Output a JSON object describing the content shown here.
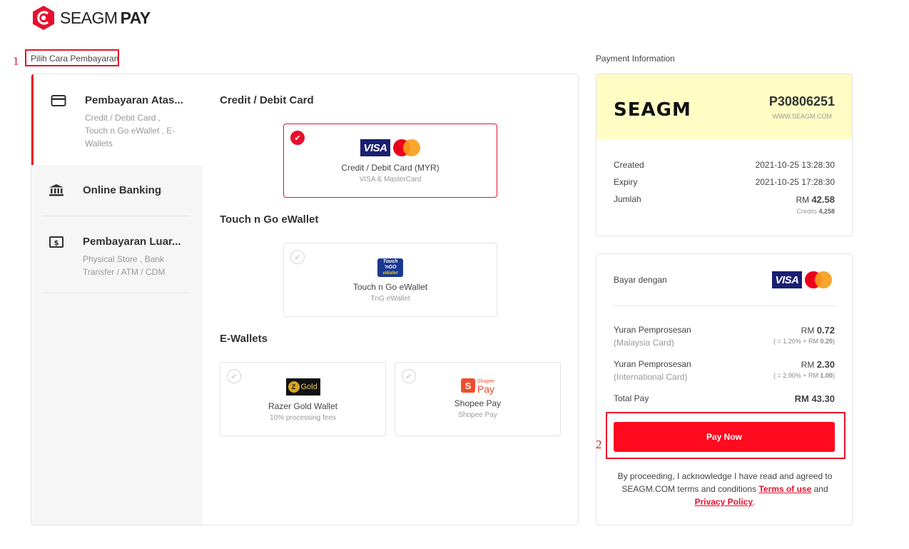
{
  "brand": {
    "name_light": "SEAGM",
    "name_bold": "PAY",
    "accent": "#e8112d"
  },
  "annotations": {
    "num1": "1",
    "num2": "2"
  },
  "left": {
    "section_label": "Pilih Cara Pembayaran",
    "menu": [
      {
        "title": "Pembayaran Atas...",
        "sub": "Credit / Debit Card , Touch n Go eWallet , E-Wallets",
        "icon": "credit-card-icon"
      },
      {
        "title": "Online Banking",
        "sub": "",
        "icon": "bank-icon"
      },
      {
        "title": "Pembayaran Luar...",
        "sub": "Physical Store , Bank Transfer / ATM / CDM",
        "icon": "cash-icon"
      }
    ],
    "groups": [
      {
        "title": "Credit / Debit Card",
        "methods": [
          {
            "name": "Credit / Debit Card (MYR)",
            "note": "VISA & MasterCard",
            "selected": true,
            "visa_label": "VISA"
          }
        ]
      },
      {
        "title": "Touch n Go eWallet",
        "methods": [
          {
            "name": "Touch n Go eWallet",
            "note": "TnG eWallet",
            "selected": false,
            "logo_l1": "Touch",
            "logo_l2": "'nGO",
            "logo_l3": "eWallet"
          }
        ]
      },
      {
        "title": "E-Wallets",
        "methods": [
          {
            "name": "Razer Gold Wallet",
            "note": "10% processing fees",
            "selected": false,
            "logo_coin": "Z",
            "logo_text": "Gold"
          },
          {
            "name": "Shopee Pay",
            "note": "Shopee Pay",
            "selected": false,
            "logo_bag": "S",
            "logo_s1": "Shopee",
            "logo_s2": "Pay"
          }
        ]
      }
    ]
  },
  "info": {
    "section_label": "Payment Information",
    "logo_word": "SEAGM",
    "order_id": "P30806251",
    "site": "WWW.SEAGM.COM",
    "created_label": "Created",
    "created_value": "2021-10-25 13:28:30",
    "expiry_label": "Expiry",
    "expiry_value": "2021-10-25 17:28:30",
    "amount_label": "Jumlah",
    "amount_currency": "RM",
    "amount_value": "42.58",
    "credits_label": "Credits",
    "credits_value": "4,258"
  },
  "pay": {
    "pay_with_label": "Bayar dengan",
    "visa_label": "VISA",
    "fee1_label": "Yuran Pemprosesan",
    "fee1_currency": "RM",
    "fee1_value": "0.72",
    "fee1_sub": "(Malaysia Card)",
    "fee1_formula_a": "( = 1.20% + RM ",
    "fee1_formula_b": "0.20",
    "fee1_formula_c": ")",
    "fee2_label": "Yuran Pemprosesan",
    "fee2_currency": "RM",
    "fee2_value": "2.30",
    "fee2_sub": "(International Card)",
    "fee2_formula_a": "( = 2.90% + RM ",
    "fee2_formula_b": "1.00",
    "fee2_formula_c": ")",
    "total_label": "Total Pay",
    "total_value": "RM 43.30",
    "button_label": "Pay Now",
    "terms_a": "By proceeding, I acknowledge I have read and agreed to SEAGM.COM terms and conditions ",
    "terms_link1": "Terms of use",
    "terms_b": " and ",
    "terms_link2": "Privacy Policy",
    "terms_c": "."
  }
}
